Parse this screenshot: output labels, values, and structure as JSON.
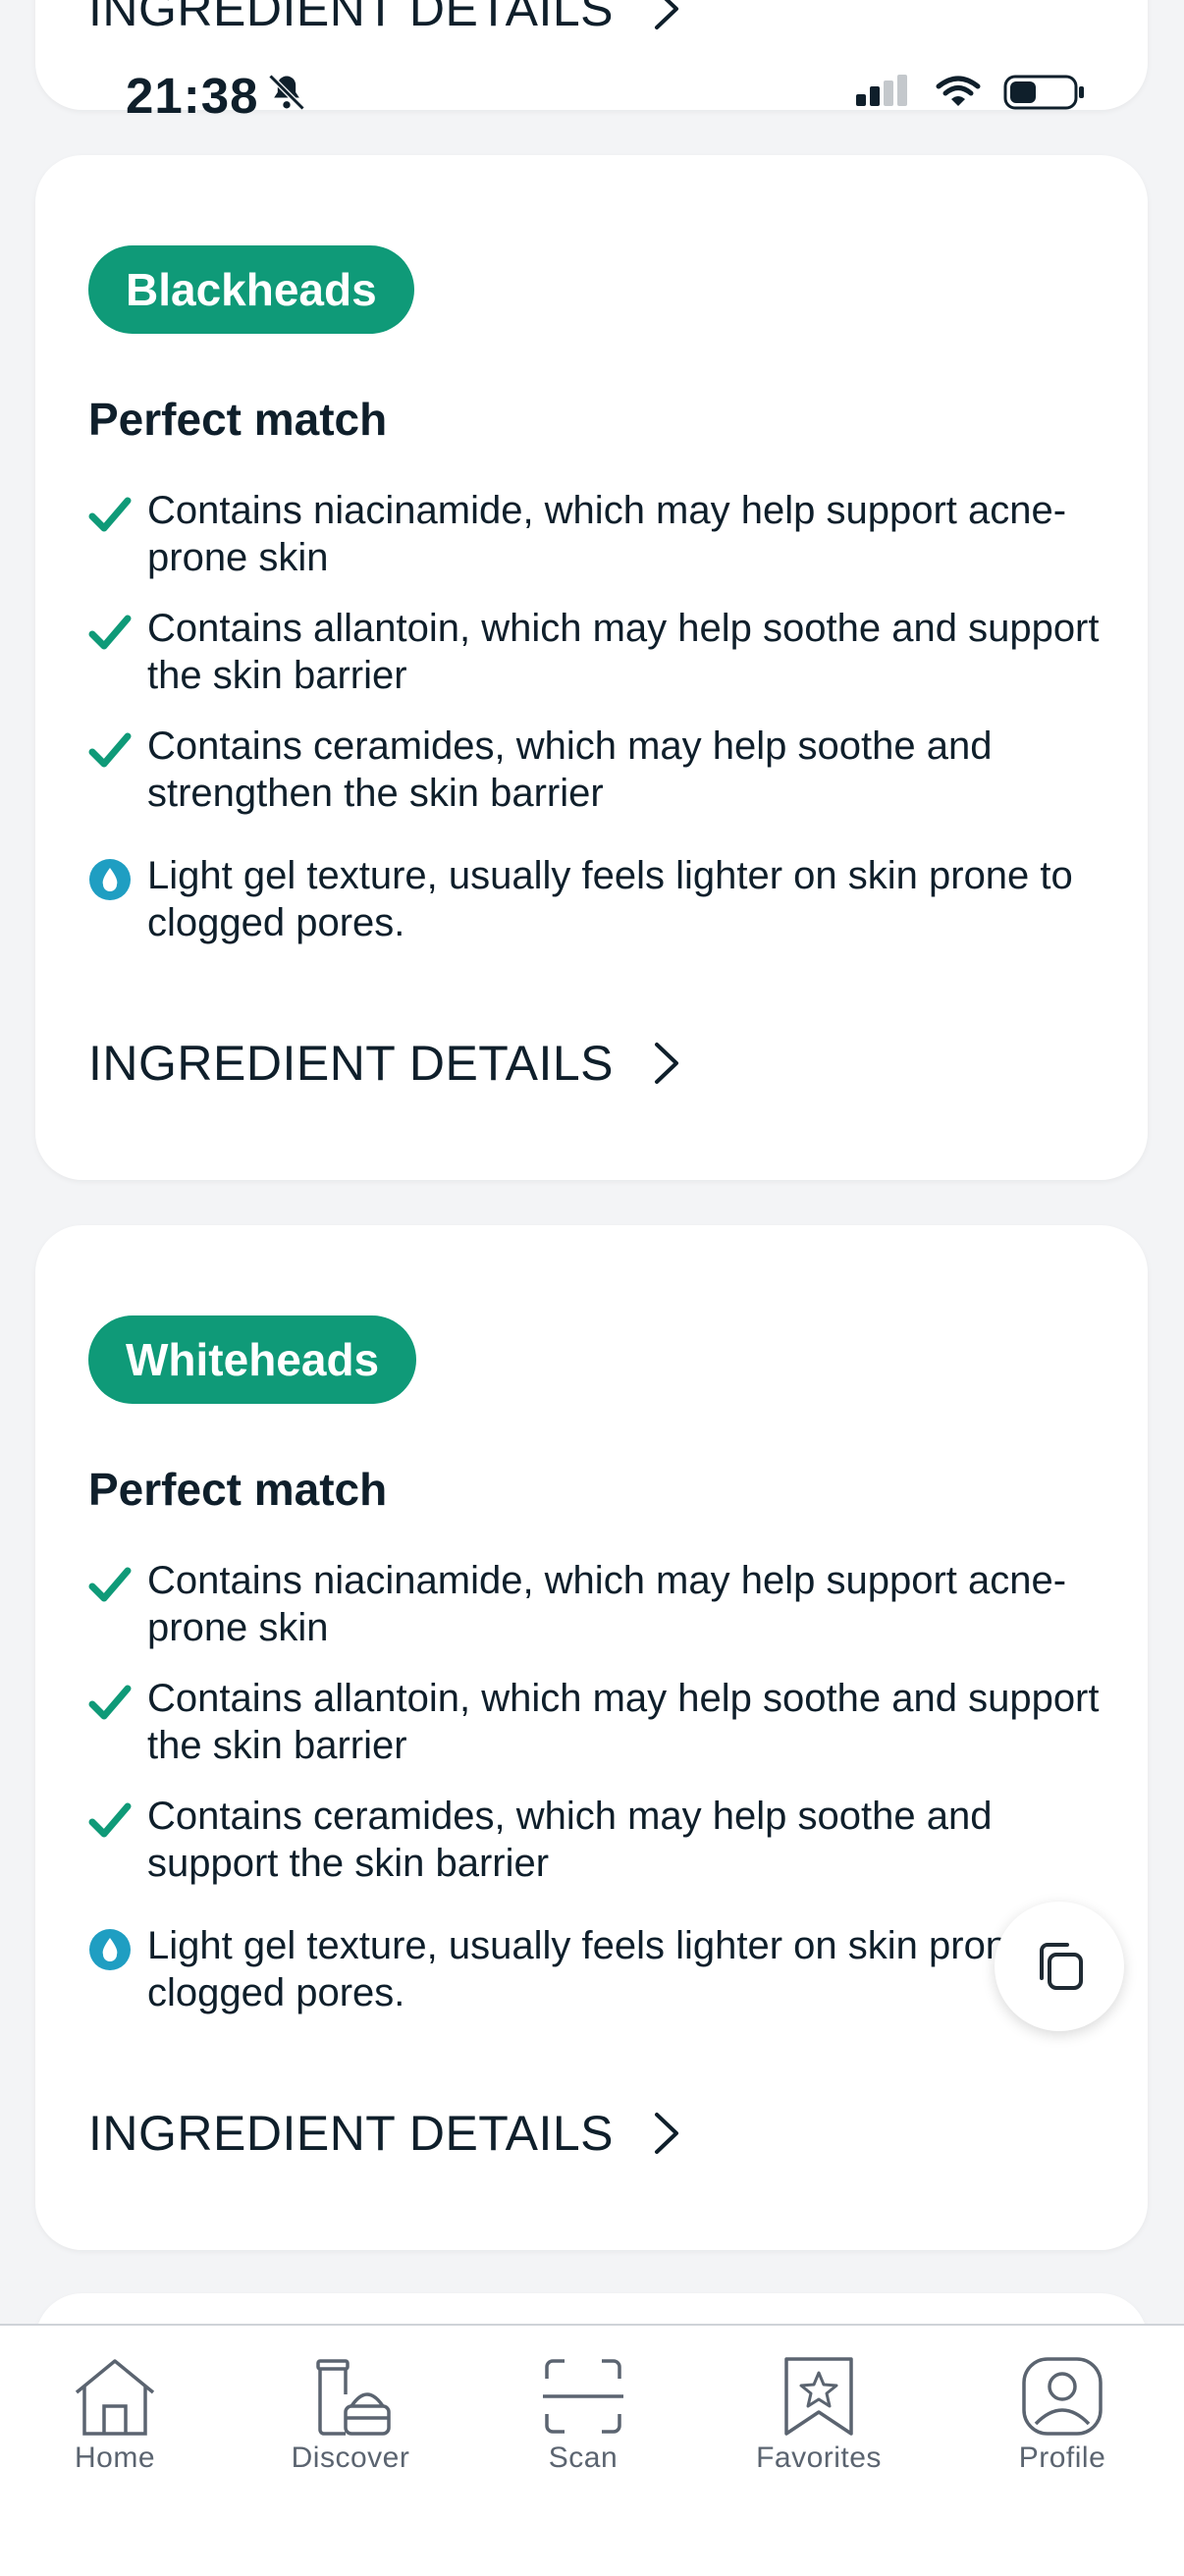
{
  "status_bar": {
    "time": "21:38"
  },
  "top_card": {
    "link_label": "INGREDIENT DETAILS"
  },
  "cards": [
    {
      "tag": "Blackheads",
      "match": "Perfect match",
      "reasons": [
        {
          "icon": "check-icon",
          "text": "Contains niacinamide, which may help support acne-prone skin"
        },
        {
          "icon": "check-icon",
          "text": "Contains allantoin, which may help soothe and support the skin barrier"
        },
        {
          "icon": "check-icon",
          "text": "Contains ceramides, which may help soothe and strengthen the skin barrier"
        },
        {
          "icon": "droplet-icon",
          "text": "Light gel texture, usually feels lighter on skin prone to clogged pores."
        }
      ],
      "link_label": "INGREDIENT DETAILS"
    },
    {
      "tag": "Whiteheads",
      "match": "Perfect match",
      "reasons": [
        {
          "icon": "check-icon",
          "text": "Contains niacinamide, which may help support acne-prone skin"
        },
        {
          "icon": "check-icon",
          "text": "Contains allantoin, which may help soothe and support the skin barrier"
        },
        {
          "icon": "check-icon",
          "text": "Contains ceramides, which may help soothe and support the skin barrier"
        },
        {
          "icon": "droplet-icon",
          "text": "Light gel texture, usually feels lighter on skin prone to clogged pores."
        }
      ],
      "link_label": "INGREDIENT DETAILS"
    }
  ],
  "tab_bar": {
    "items": [
      {
        "label": "Home",
        "icon": "home-icon"
      },
      {
        "label": "Discover",
        "icon": "products-icon"
      },
      {
        "label": "Scan",
        "icon": "scan-icon"
      },
      {
        "label": "Favorites",
        "icon": "bookmark-star-icon"
      },
      {
        "label": "Profile",
        "icon": "profile-icon"
      }
    ]
  },
  "colors": {
    "accent": "#0f9a78",
    "droplet": "#1f9ec2",
    "text": "#0f1f2b",
    "background": "#f3f4f6"
  }
}
